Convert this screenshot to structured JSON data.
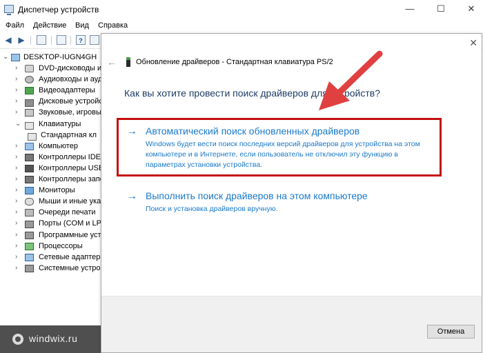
{
  "window": {
    "title": "Диспетчер устройств",
    "controls": {
      "minimize": "—",
      "maximize": "☐",
      "close": "✕"
    }
  },
  "menu": [
    "Файл",
    "Действие",
    "Вид",
    "Справка"
  ],
  "tree": {
    "root": "DESKTOP-IUGN4GH",
    "items": [
      {
        "label": "DVD-дисководы и д",
        "icon": "dvd-drive-icon"
      },
      {
        "label": "Аудиовходы и ауд",
        "icon": "audio-icon"
      },
      {
        "label": "Видеоадаптеры",
        "icon": "video-adapter-icon"
      },
      {
        "label": "Дисковые устройст",
        "icon": "disk-drive-icon"
      },
      {
        "label": "Звуковые, игровы",
        "icon": "sound-icon"
      },
      {
        "label": "Клавиатуры",
        "icon": "keyboard-icon",
        "expanded": true
      },
      {
        "label": "Стандартная кл",
        "icon": "keyboard-icon",
        "child": true
      },
      {
        "label": "Компьютер",
        "icon": "computer-icon"
      },
      {
        "label": "Контроллеры IDE",
        "icon": "ide-controller-icon"
      },
      {
        "label": "Контроллеры USB",
        "icon": "usb-controller-icon"
      },
      {
        "label": "Контроллеры запо",
        "icon": "storage-controller-icon"
      },
      {
        "label": "Мониторы",
        "icon": "monitor-icon"
      },
      {
        "label": "Мыши и иные ука",
        "icon": "mouse-icon"
      },
      {
        "label": "Очереди печати",
        "icon": "printer-icon"
      },
      {
        "label": "Порты (COM и LP",
        "icon": "port-icon"
      },
      {
        "label": "Программные уст",
        "icon": "software-device-icon"
      },
      {
        "label": "Процессоры",
        "icon": "processor-icon"
      },
      {
        "label": "Сетевые адаптеры",
        "icon": "network-adapter-icon"
      },
      {
        "label": "Системные устро",
        "icon": "system-device-icon"
      }
    ]
  },
  "dialog": {
    "title": "Обновление драйверов - Стандартная клавиатура PS/2",
    "question": "Как вы хотите провести поиск драйверов для устройств?",
    "option_auto": {
      "title": "Автоматический поиск обновленных драйверов",
      "description": "Windows будет вести поиск последних версий драйверов для устройства на этом компьютере и в Интернете, если пользователь не отключил эту функцию в параметрах установки устройства."
    },
    "option_manual": {
      "title": "Выполнить поиск драйверов на этом компьютере",
      "description": "Поиск и установка драйверов вручную."
    },
    "cancel_label": "Отмена"
  },
  "watermark": "windwix.ru",
  "colors": {
    "link": "#1979ca",
    "highlight": "#c40d0d",
    "arrow": "#e04040"
  }
}
